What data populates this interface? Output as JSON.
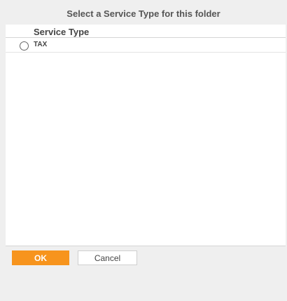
{
  "dialog": {
    "title": "Select a Service Type for this folder"
  },
  "table": {
    "column_header": "Service Type",
    "options": [
      {
        "label": "TAX",
        "selected": false
      }
    ]
  },
  "buttons": {
    "ok_label": "OK",
    "cancel_label": "Cancel"
  },
  "colors": {
    "accent": "#f7941d",
    "background": "#efefef"
  }
}
